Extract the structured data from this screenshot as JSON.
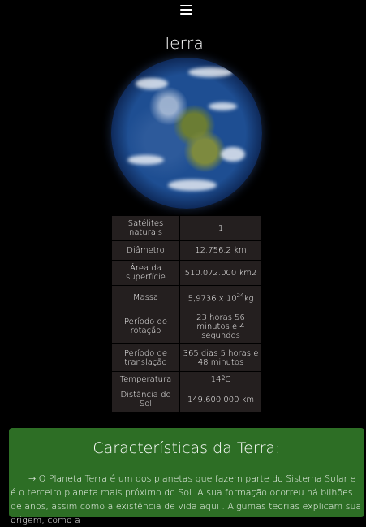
{
  "page": {
    "title": "Terra",
    "menu_icon": "hamburger-menu-icon"
  },
  "image": {
    "alt": "Planeta Terra"
  },
  "facts": [
    {
      "label": "Satélites naturais",
      "value": "1"
    },
    {
      "label": "Diâmetro",
      "value": "12.756,2 km"
    },
    {
      "label": "Área da superfície",
      "value": "510.072.000 km2"
    },
    {
      "label": "Massa",
      "value_base": "5,9736 x 10",
      "value_exp": "24",
      "value_unit": "kg"
    },
    {
      "label": "Período de rotação",
      "value": "23 horas 56 minutos e 4 segundos"
    },
    {
      "label": "Período de translação",
      "value": "365 dias 5 horas e 48 minutos"
    },
    {
      "label": "Temperatura",
      "value": "14ºC"
    },
    {
      "label": "Distância do Sol",
      "value": "149.600.000 km"
    }
  ],
  "characteristics": {
    "heading": "Características da Terra:",
    "text": "→ O Planeta Terra é um dos planetas que fazem parte do Sistema Solar e é o terceiro planeta mais próximo do Sol. A sua formação ocorreu há bilhões de anos, assim como a existência de vida aqui . Algumas teorias explicam sua origem, como a"
  },
  "colors": {
    "background": "#000000",
    "table_cell": "#241f1f",
    "card": "#2d6e25"
  }
}
